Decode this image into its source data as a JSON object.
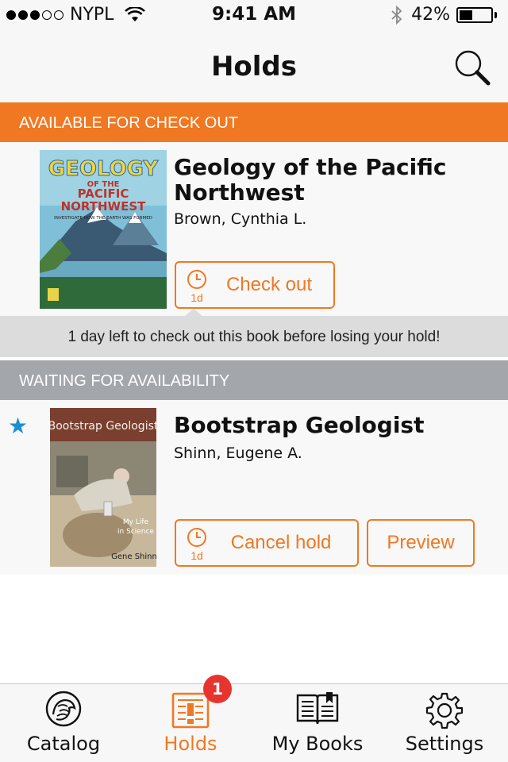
{
  "status_bar": {
    "carrier": "NYPL",
    "time": "9:41 AM",
    "battery": "42%",
    "battery_level": 0.42,
    "signal_bars": 3
  },
  "nav": {
    "title": "Holds",
    "search_icon": "search-icon"
  },
  "sections": {
    "available": "AVAILABLE FOR CHECK OUT",
    "waiting": "WAITING FOR AVAILABILITY"
  },
  "books": [
    {
      "title": "Geology of the Pacific Northwest",
      "author": "Brown, Cynthia L.",
      "cover_text": {
        "line1": "GEOLOGY",
        "line2": "OF THE",
        "line3": "PACIFIC",
        "line4": "NORTHWEST",
        "subtitle": "INVESTIGATE HOW THE EARTH WAS FORMED"
      },
      "primary_button": "Check out",
      "time_left": "1d",
      "notice": "1 day left to check out this book before losing your hold!"
    },
    {
      "title": "Bootstrap Geologist",
      "author": "Shinn, Eugene A.",
      "cover_text": {
        "title": "Bootstrap Geologist",
        "tagline1": "My Life",
        "tagline2": "in Science",
        "author": "Gene Shinn"
      },
      "primary_button": "Cancel hold",
      "secondary_button": "Preview",
      "time_left": "1d",
      "starred": true
    }
  ],
  "tabs": [
    {
      "label": "Catalog",
      "icon": "lion-icon",
      "active": false
    },
    {
      "label": "Holds",
      "icon": "holds-icon",
      "active": true,
      "badge": "1"
    },
    {
      "label": "My Books",
      "icon": "books-icon",
      "active": false
    },
    {
      "label": "Settings",
      "icon": "gear-icon",
      "active": false
    }
  ],
  "colors": {
    "accent": "#f07822",
    "waiting_header": "#a3a6ab",
    "badge": "#e7342f",
    "star": "#1a8fd1"
  }
}
